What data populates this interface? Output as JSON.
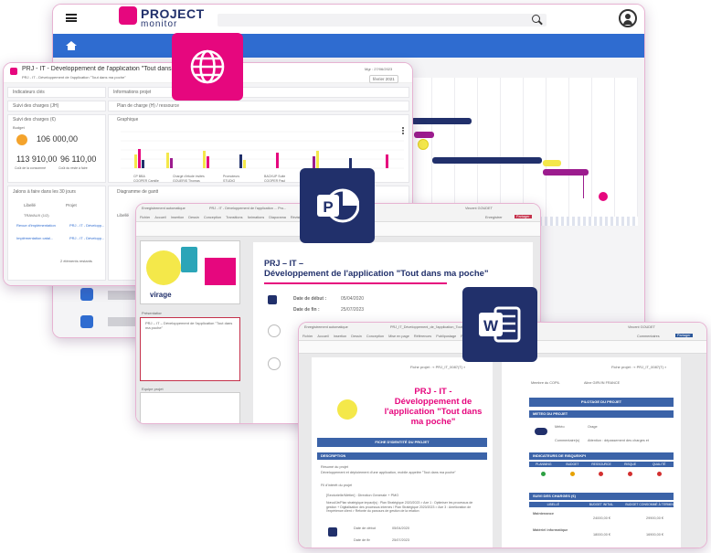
{
  "colors": {
    "brand": "#e6077e",
    "navy": "#21306b",
    "blue": "#3b63a8",
    "yellow": "#f4e84a",
    "purple": "#9c1c8e"
  },
  "back": {
    "logo_line1": "PROJECT",
    "logo_line2": "monitor",
    "menu_icon": "hamburger-icon",
    "search_icon": "search-icon",
    "user_icon": "user-icon",
    "home_icon": "home-icon"
  },
  "dash": {
    "title": "PRJ - IT - Développement de l'application \"Tout dans ma poche\"",
    "subtitle": "PRJ - IT - Développement de l'application \"Tout dans ma poche\"",
    "date": "Mgr : 27/06/2023",
    "filter": "février 2021",
    "indicators": "Indicateurs clés",
    "info": "Informations projet",
    "changes_short": "Suivi des charges (JH)",
    "plan": "Plan de charge (H) / ressource",
    "changes": "Suivi des charges (€)",
    "graph": "Graphique",
    "amount_big": "106 000,00",
    "amount_left": "113 910,00",
    "amount_right": "96 110,00",
    "lbl_budget": "Budget",
    "lbl_consumed": "Coût de la consommé",
    "lbl_remaining": "Coût du reste à faire",
    "tasks": "Jalons à faire dans les 30 jours",
    "col_label": "Libellé",
    "col_project": "Projet",
    "row_group": "TRAVAUX (1/2)",
    "row1": "Revue d'implémentation",
    "row1_proj": "PRJ - IT - Développ...",
    "row2": "Implémentation catal...",
    "row2_proj": "PRJ - IT - Développ...",
    "more": "2 éléments restants",
    "gantt": "Diagramme de gantt",
    "gantt_col": "Libellé",
    "legend": [
      "CP BBA",
      "Chargé d'étude invités",
      "Promoteurs",
      "BACKUP Suite",
      "COOPER Camille",
      "GOUERIS Thomas",
      "STUDIO",
      "COOPER Paul"
    ]
  },
  "ppt": {
    "tab1": "Enregistrement automatique",
    "file": "PRJ - IT - Développement de l'application ... Pro...",
    "user": "Vincent GOUDET",
    "menu": [
      "Fichier",
      "Accueil",
      "Insertion",
      "Dessin",
      "Conception",
      "Transitions",
      "Animations",
      "Diaporama",
      "Révision",
      "Affichage",
      "Aide"
    ],
    "record": "Enregistrer",
    "share": "Partager",
    "brand": "virage",
    "slide_title_a": "PRJ – IT –",
    "slide_title_b": "Développement de l'application \"Tout dans ma poche\"",
    "start_label": "Date de début :",
    "start_val": "05/04/2020",
    "end_label": "Date de fin :",
    "end_val": "25/07/2023",
    "thumb_title": "PRJ – IT – Développement de l'application \"Tout dans ma poche\"",
    "section1": "Présentation",
    "section2": "Equipe projet",
    "card_line": "PRJ - IT - Développement de l'application \"Tout dans ma poche\""
  },
  "word": {
    "tab1": "Enregistrement automatique",
    "file": "PRJ_IT_Développement_de_l'application_Tout_dans_ma_poche...",
    "user": "Vincent GOUDET",
    "menu": [
      "Fichier",
      "Accueil",
      "Insertion",
      "Dessin",
      "Conception",
      "Mise en page",
      "Références",
      "Publipostage",
      "Révision",
      "Affichage",
      "Aide"
    ],
    "comments": "Commentaires",
    "share": "Partager",
    "page_ref": "Fiche projet : « PRJ_IT_0087(T) »",
    "doc_title": "PRJ - IT - Développement de l'application \"Tout dans ma poche\"",
    "identity": "FICHE D'IDENTITÉ DU PROJET",
    "description": "DESCRIPTION",
    "summary_label": "Résumé du projet",
    "summary": "Développement et déploiement d'une application, mobile appelée \"Tout dans ma poche\"",
    "objectives": "Fil d'intérêt du projet",
    "bullet1": "[Sectorielle/Métier] : Direction Generale + PMO",
    "bullet2": "Nœud/Je/Plan stratégique impact(s) : Plan Stratégique 2020/2023 > Axe 1 : Optimiser les processus de gestion + Digitalisation des processus internes / Plan Stratégique 2020/2023 > Axe 3 : Amélioration de l'expérience client > Refonte du parcours de gestion de la relation",
    "start_label": "Date de début",
    "start_val": "05/04/2020",
    "end_label": "Date de fin",
    "end_val": "25/07/2023",
    "right_ref": "Fiche projet : « PRJ_IT_0087(T) »",
    "copil": "Membre du COPIL",
    "copil_val": "Aline GIRVIN FRANCE",
    "pilotage": "PILOTAGE DU PROJET",
    "weather": "METEO DU PROJET",
    "meteo": "Météo",
    "meteo_val": "Orage",
    "comment": "Commentaire(s)",
    "comment_val": "Attention : dépassement des charges et",
    "kpi": "INDICATEURS DE RISQUE/KPI",
    "kpi_cols": [
      "PLANNING",
      "BUDGET",
      "RESSOURCE",
      "RISQUE",
      "QUALITÉ"
    ],
    "charges": "SUIVI DES CHARGES (€)",
    "ch_cols": [
      "LIBELLÉ",
      "BUDGET INITIAL",
      "BUDGET CONSOMMÉ À TERMINER"
    ],
    "ch_row1": "Maintenance",
    "ch_row1_v": "24000,00 €",
    "ch_row1_w": "29900,00 €",
    "ch_row2": "Matériel informatique",
    "ch_row2_v": "18000,00 €",
    "ch_row2_w": "16900,00 €"
  }
}
